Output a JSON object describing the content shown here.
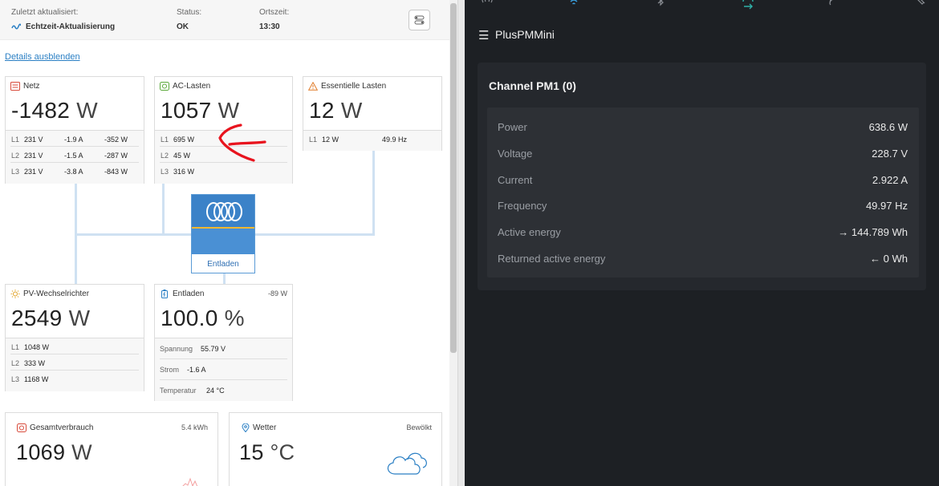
{
  "header": {
    "last_updated_label": "Zuletzt aktualisiert:",
    "last_updated_value": "Echtzeit-Aktualisierung",
    "status_label": "Status:",
    "status_value": "OK",
    "local_time_label": "Ortszeit:",
    "local_time_value": "13:30"
  },
  "details_link": "Details ausblenden",
  "grid": {
    "title": "Netz",
    "value": "-1482",
    "unit": "W",
    "rows": [
      {
        "phase": "L1",
        "voltage": "231 V",
        "current": "-1.9 A",
        "power": "-352 W"
      },
      {
        "phase": "L2",
        "voltage": "231 V",
        "current": "-1.5 A",
        "power": "-287 W"
      },
      {
        "phase": "L3",
        "voltage": "231 V",
        "current": "-3.8 A",
        "power": "-843 W"
      }
    ]
  },
  "ac_loads": {
    "title": "AC-Lasten",
    "value": "1057",
    "unit": "W",
    "rows": [
      {
        "phase": "L1",
        "power": "695 W"
      },
      {
        "phase": "L2",
        "power": "45 W"
      },
      {
        "phase": "L3",
        "power": "316 W"
      }
    ]
  },
  "essential_loads": {
    "title": "Essentielle Lasten",
    "value": "12",
    "unit": "W",
    "rows": [
      {
        "phase": "L1",
        "power": "12 W",
        "frequency": "49.9 Hz"
      }
    ]
  },
  "inverter": {
    "label": "Entladen"
  },
  "pv": {
    "title": "PV-Wechselrichter",
    "value": "2549",
    "unit": "W",
    "rows": [
      {
        "phase": "L1",
        "power": "1048 W"
      },
      {
        "phase": "L2",
        "power": "333 W"
      },
      {
        "phase": "L3",
        "power": "1168 W"
      }
    ]
  },
  "battery": {
    "title": "Entladen",
    "power": "-89 W",
    "value": "100.0",
    "unit": "%",
    "voltage_label": "Spannung",
    "voltage_value": "55.79 V",
    "current_label": "Strom",
    "current_value": "-1.6 A",
    "temp_label": "Temperatur",
    "temp_value": "24 °C"
  },
  "total_consumption": {
    "title": "Gesamtverbrauch",
    "energy": "5.4 kWh",
    "value": "1069",
    "unit": "W"
  },
  "weather": {
    "title": "Wetter",
    "condition": "Bewölkt",
    "value": "15",
    "unit": "°C"
  },
  "right_panel": {
    "app_title": "PlusPMMini",
    "channel_title": "Channel PM1 (0)",
    "rows": [
      {
        "label": "Power",
        "value": "638.6 W"
      },
      {
        "label": "Voltage",
        "value": "228.7 V"
      },
      {
        "label": "Current",
        "value": "2.922 A"
      },
      {
        "label": "Frequency",
        "value": "49.97 Hz"
      },
      {
        "label": "Active energy",
        "value": "→ 144.789 Wh"
      },
      {
        "label": "Returned active energy",
        "value": "← 0 Wh"
      }
    ]
  },
  "colors": {
    "accent_blue": "#3b82c8",
    "annotation_red": "#e8141e",
    "dark_bg": "#1d2024",
    "card_dark": "#25282d"
  },
  "icons": [
    "wave-icon",
    "grid-icon",
    "plug-icon",
    "warning-icon",
    "sun-icon",
    "battery-icon",
    "consumption-icon",
    "location-icon",
    "cloud-icon",
    "hamburger-icon",
    "settings-toggle-icon",
    "antenna-icon",
    "wifi-icon",
    "bluetooth-icon",
    "sync-icon",
    "rss-icon"
  ]
}
